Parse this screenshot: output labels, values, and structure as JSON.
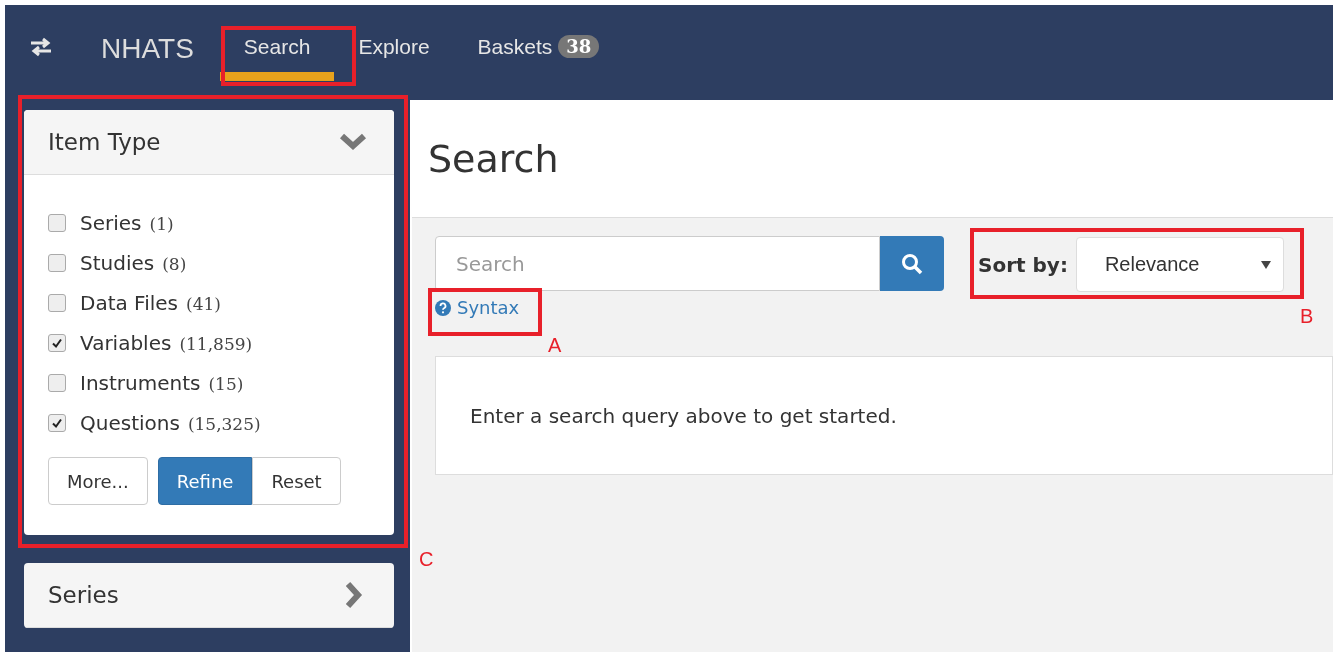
{
  "navbar": {
    "brand": "NHATS",
    "tabs": [
      {
        "label": "Search",
        "selected": true
      },
      {
        "label": "Explore",
        "selected": false
      },
      {
        "label": "Baskets",
        "selected": false,
        "badge": "38"
      }
    ]
  },
  "sidebar": {
    "panels": [
      {
        "title": "Item Type",
        "expanded": true,
        "options": [
          {
            "label": "Series",
            "count": "(1)",
            "checked": false
          },
          {
            "label": "Studies",
            "count": "(8)",
            "checked": false
          },
          {
            "label": "Data Files",
            "count": "(41)",
            "checked": false
          },
          {
            "label": "Variables",
            "count": "(11,859)",
            "checked": true
          },
          {
            "label": "Instruments",
            "count": "(15)",
            "checked": false
          },
          {
            "label": "Questions",
            "count": "(15,325)",
            "checked": true
          }
        ],
        "buttons": [
          {
            "label": "More...",
            "primary": false
          },
          {
            "label": "Refine",
            "primary": true
          },
          {
            "label": "Reset",
            "primary": false
          }
        ]
      },
      {
        "title": "Series",
        "expanded": false
      }
    ]
  },
  "main": {
    "title": "Search",
    "search": {
      "placeholder": "Search"
    },
    "syntax_link": "Syntax",
    "sort": {
      "label": "Sort by:",
      "value": "Relevance"
    },
    "message": "Enter a search query above to get started."
  },
  "annotations": [
    {
      "label": "A"
    },
    {
      "label": "B"
    },
    {
      "label": "C"
    }
  ]
}
